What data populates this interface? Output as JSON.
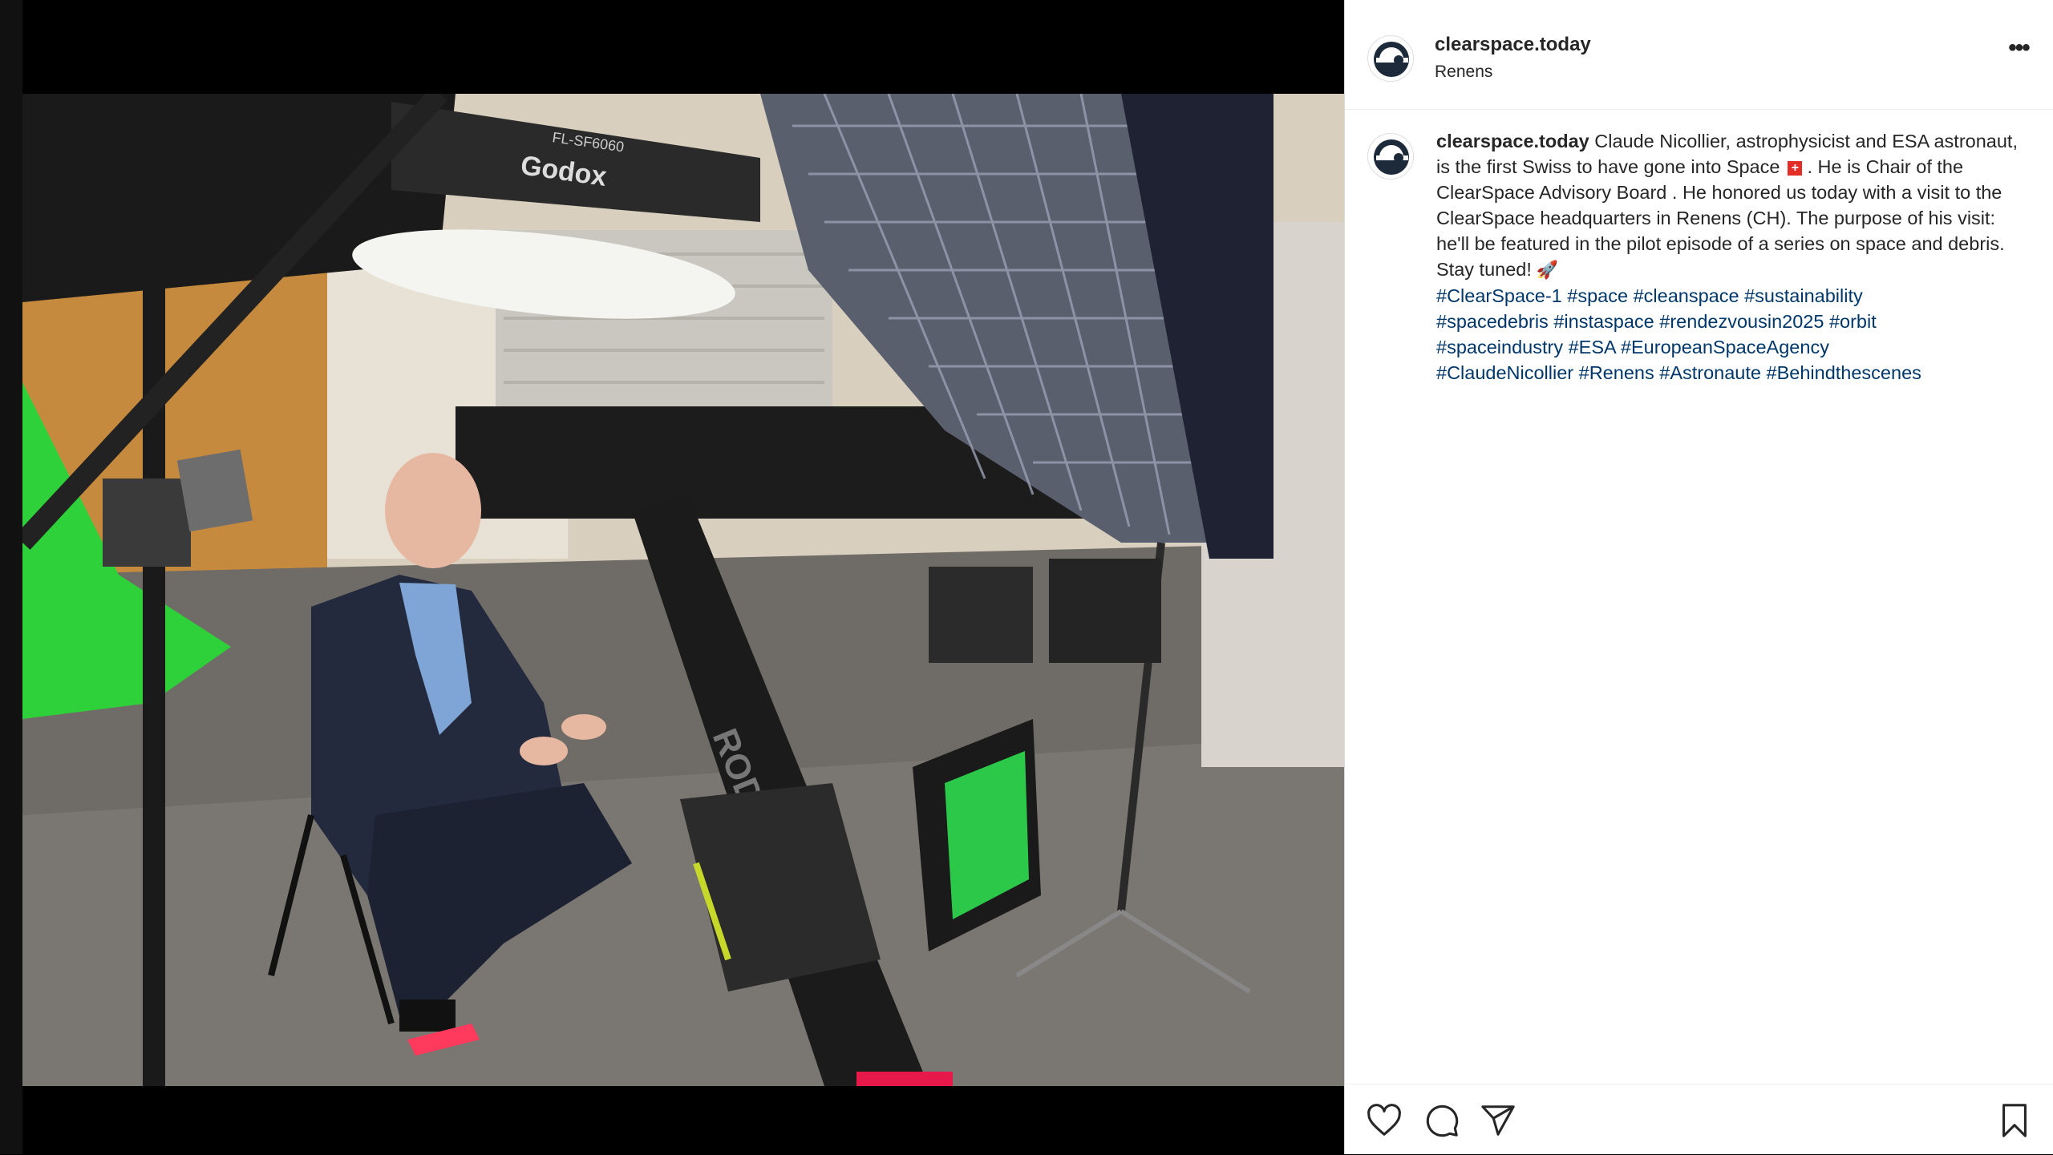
{
  "post": {
    "username": "clearspace.today",
    "location": "Renens",
    "more_label": "•••",
    "caption": {
      "text_part1": "Claude Nicollier, astrophysicist and ESA astronaut, is the first Swiss to have gone into Space",
      "text_part2": ". He is Chair of the ClearSpace Advisory Board . He honored us today with a visit to the ClearSpace headquarters in Renens (CH). The purpose of his visit: he'll be featured in the pilot episode of a series on space and debris. Stay tuned!",
      "flag_glyph": "+",
      "rocket_glyph": "🚀",
      "hashtags": [
        "#ClearSpace-1",
        "#space",
        "#cleanspace",
        "#sustainability",
        "#spacedebris",
        "#instaspace",
        "#rendezvousin2025",
        "#orbit",
        "#spaceindustry",
        "#ESA",
        "#EuropeanSpaceAgency",
        "#ClaudeNicollier",
        "#Renens",
        "#Astronaute",
        "#Behindthescenes"
      ]
    }
  },
  "photo": {
    "softbox_brand": "Godox",
    "softbox_model": "FL-SF6060",
    "mic_brand": "RODE"
  },
  "icons": {
    "like": "heart-icon",
    "comment": "comment-icon",
    "share": "send-icon",
    "save": "bookmark-icon"
  },
  "colors": {
    "text": "#262626",
    "hashtag": "#00376b",
    "border": "#efefef"
  }
}
